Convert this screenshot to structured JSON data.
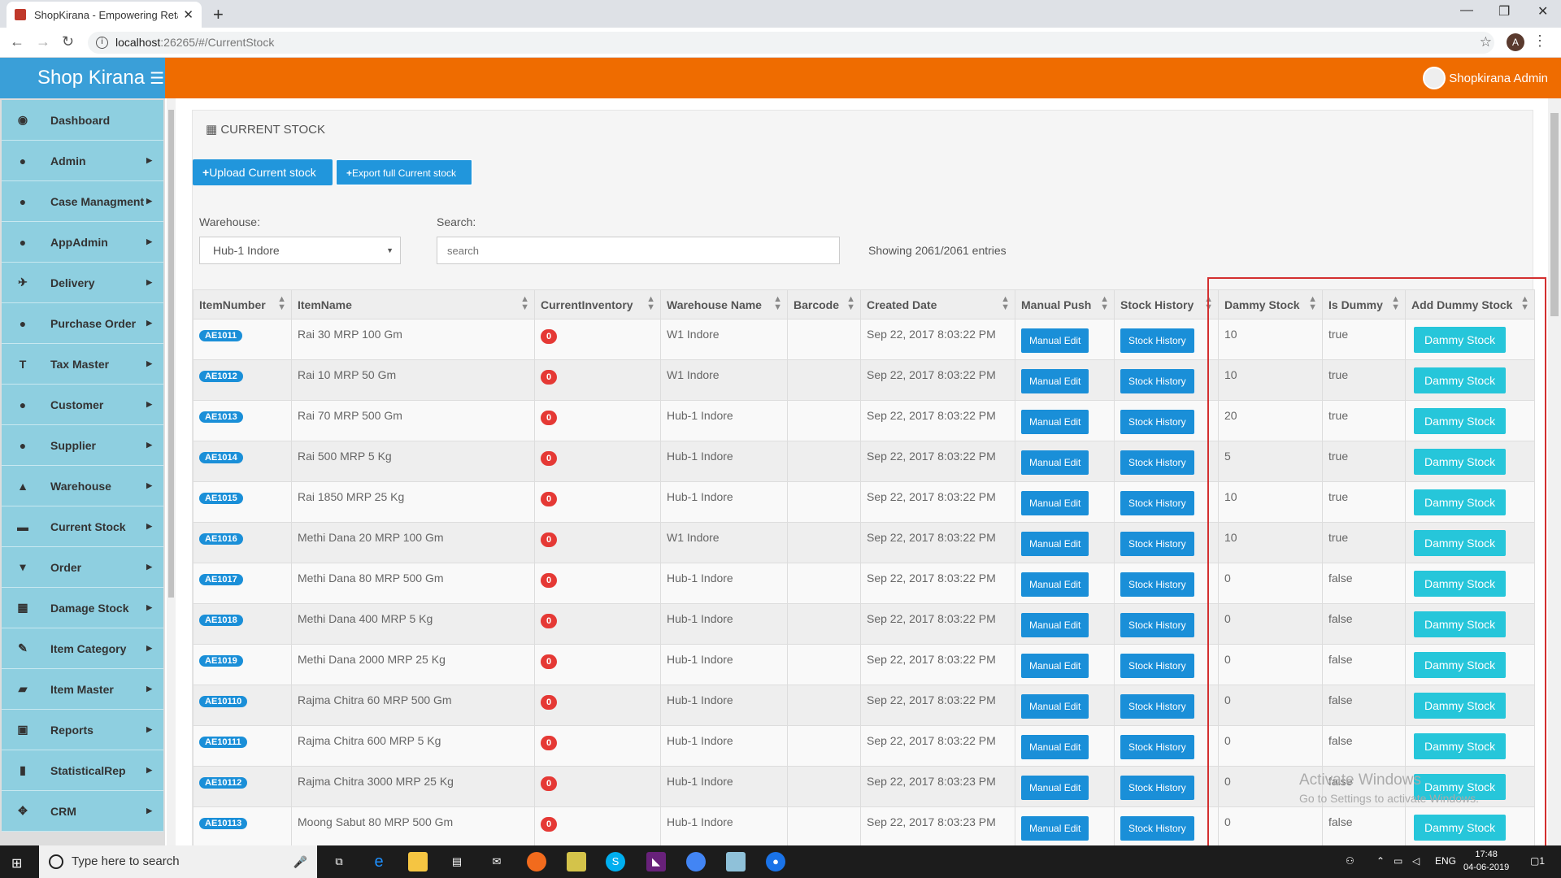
{
  "browser": {
    "tab_title": "ShopKirana - Empowering Retail",
    "url_host": "localhost",
    "url_path": ":26265/#/CurrentStock",
    "profile_initial": "A"
  },
  "app": {
    "brand": "Shop Kirana",
    "user_name": "Shopkirana Admin"
  },
  "sidebar": {
    "items": [
      {
        "label": "Dashboard",
        "icon": "dashboard-icon",
        "glyph": "◉",
        "submenu": false
      },
      {
        "label": "Admin",
        "icon": "user-icon",
        "glyph": "●",
        "submenu": true
      },
      {
        "label": "Case Managment",
        "icon": "user-icon",
        "glyph": "●",
        "submenu": true
      },
      {
        "label": "AppAdmin",
        "icon": "user-icon",
        "glyph": "●",
        "submenu": true
      },
      {
        "label": "Delivery",
        "icon": "plane-icon",
        "glyph": "✈",
        "submenu": true
      },
      {
        "label": "Purchase Order",
        "icon": "user-icon",
        "glyph": "●",
        "submenu": true
      },
      {
        "label": "Tax Master",
        "icon": "text-icon",
        "glyph": "T",
        "submenu": true
      },
      {
        "label": "Customer",
        "icon": "user-icon",
        "glyph": "●",
        "submenu": true
      },
      {
        "label": "Supplier",
        "icon": "user-icon",
        "glyph": "●",
        "submenu": true
      },
      {
        "label": "Warehouse",
        "icon": "road-icon",
        "glyph": "▲",
        "submenu": true
      },
      {
        "label": "Current Stock",
        "icon": "drawer-icon",
        "glyph": "▬",
        "submenu": true
      },
      {
        "label": "Order",
        "icon": "cart-icon",
        "glyph": "▾",
        "submenu": true
      },
      {
        "label": "Damage Stock",
        "icon": "archive-icon",
        "glyph": "▦",
        "submenu": true
      },
      {
        "label": "Item Category",
        "icon": "pencil-icon",
        "glyph": "✎",
        "submenu": true
      },
      {
        "label": "Item Master",
        "icon": "folder-icon",
        "glyph": "▰",
        "submenu": true
      },
      {
        "label": "Reports",
        "icon": "briefcase-icon",
        "glyph": "▣",
        "submenu": true
      },
      {
        "label": "StatisticalRep",
        "icon": "bar-chart-icon",
        "glyph": "▮",
        "submenu": true
      },
      {
        "label": "CRM",
        "icon": "move-icon",
        "glyph": "✥",
        "submenu": true
      }
    ]
  },
  "page": {
    "title": "CURRENT STOCK",
    "upload_btn": "Upload Current stock",
    "export_btn": "Export full Current stock",
    "warehouse_label": "Warehouse:",
    "warehouse_value": "Hub-1 Indore",
    "search_label": "Search:",
    "search_placeholder": "search",
    "showing": "Showing 2061/2061 entries"
  },
  "table": {
    "headers": [
      "ItemNumber",
      "ItemName",
      "CurrentInventory",
      "Warehouse Name",
      "Barcode",
      "Created Date",
      "Manual Push",
      "Stock History",
      "Dammy Stock",
      "Is Dummy",
      "Add Dummy Stock"
    ],
    "manual_btn": "Manual Edit",
    "history_btn": "Stock History",
    "dummy_btn": "Dammy Stock",
    "rows": [
      {
        "item": "AE1011",
        "name": "Rai 30 MRP 100 Gm",
        "inv": "0",
        "wh": "W1 Indore",
        "barcode": "",
        "date": "Sep 22, 2017 8:03:22 PM",
        "dammy": "10",
        "is_dummy": "true"
      },
      {
        "item": "AE1012",
        "name": "Rai 10 MRP 50 Gm",
        "inv": "0",
        "wh": "W1 Indore",
        "barcode": "",
        "date": "Sep 22, 2017 8:03:22 PM",
        "dammy": "10",
        "is_dummy": "true"
      },
      {
        "item": "AE1013",
        "name": "Rai 70 MRP 500 Gm",
        "inv": "0",
        "wh": "Hub-1 Indore",
        "barcode": "",
        "date": "Sep 22, 2017 8:03:22 PM",
        "dammy": "20",
        "is_dummy": "true"
      },
      {
        "item": "AE1014",
        "name": "Rai 500 MRP 5 Kg",
        "inv": "0",
        "wh": "Hub-1 Indore",
        "barcode": "",
        "date": "Sep 22, 2017 8:03:22 PM",
        "dammy": "5",
        "is_dummy": "true"
      },
      {
        "item": "AE1015",
        "name": "Rai 1850 MRP 25 Kg",
        "inv": "0",
        "wh": "Hub-1 Indore",
        "barcode": "",
        "date": "Sep 22, 2017 8:03:22 PM",
        "dammy": "10",
        "is_dummy": "true"
      },
      {
        "item": "AE1016",
        "name": "Methi Dana 20 MRP 100 Gm",
        "inv": "0",
        "wh": "W1 Indore",
        "barcode": "",
        "date": "Sep 22, 2017 8:03:22 PM",
        "dammy": "10",
        "is_dummy": "true"
      },
      {
        "item": "AE1017",
        "name": "Methi Dana 80 MRP 500 Gm",
        "inv": "0",
        "wh": "Hub-1 Indore",
        "barcode": "",
        "date": "Sep 22, 2017 8:03:22 PM",
        "dammy": "0",
        "is_dummy": "false"
      },
      {
        "item": "AE1018",
        "name": "Methi Dana 400 MRP 5 Kg",
        "inv": "0",
        "wh": "Hub-1 Indore",
        "barcode": "",
        "date": "Sep 22, 2017 8:03:22 PM",
        "dammy": "0",
        "is_dummy": "false"
      },
      {
        "item": "AE1019",
        "name": "Methi Dana 2000 MRP 25 Kg",
        "inv": "0",
        "wh": "Hub-1 Indore",
        "barcode": "",
        "date": "Sep 22, 2017 8:03:22 PM",
        "dammy": "0",
        "is_dummy": "false"
      },
      {
        "item": "AE10110",
        "name": "Rajma Chitra 60 MRP 500 Gm",
        "inv": "0",
        "wh": "Hub-1 Indore",
        "barcode": "",
        "date": "Sep 22, 2017 8:03:22 PM",
        "dammy": "0",
        "is_dummy": "false"
      },
      {
        "item": "AE10111",
        "name": "Rajma Chitra 600 MRP 5 Kg",
        "inv": "0",
        "wh": "Hub-1 Indore",
        "barcode": "",
        "date": "Sep 22, 2017 8:03:22 PM",
        "dammy": "0",
        "is_dummy": "false"
      },
      {
        "item": "AE10112",
        "name": "Rajma Chitra 3000 MRP 25 Kg",
        "inv": "0",
        "wh": "Hub-1 Indore",
        "barcode": "",
        "date": "Sep 22, 2017 8:03:23 PM",
        "dammy": "0",
        "is_dummy": "false"
      },
      {
        "item": "AE10113",
        "name": "Moong Sabut 80 MRP 500 Gm",
        "inv": "0",
        "wh": "Hub-1 Indore",
        "barcode": "",
        "date": "Sep 22, 2017 8:03:23 PM",
        "dammy": "0",
        "is_dummy": "false"
      }
    ]
  },
  "watermark": {
    "line1": "Activate Windows",
    "line2": "Go to Settings to activate Windows."
  },
  "taskbar": {
    "search_placeholder": "Type here to search",
    "lang": "ENG",
    "time": "17:48",
    "date": "04-06-2019",
    "notifications": "1"
  },
  "colors": {
    "brand": "#3a9fd8",
    "topbar": "#ef6c00",
    "sidebar_item": "#8ecfe0",
    "primary_button": "#2196dc",
    "dummy_button": "#26c6da",
    "badge_red": "#e53935",
    "highlight": "#d32f2f"
  }
}
